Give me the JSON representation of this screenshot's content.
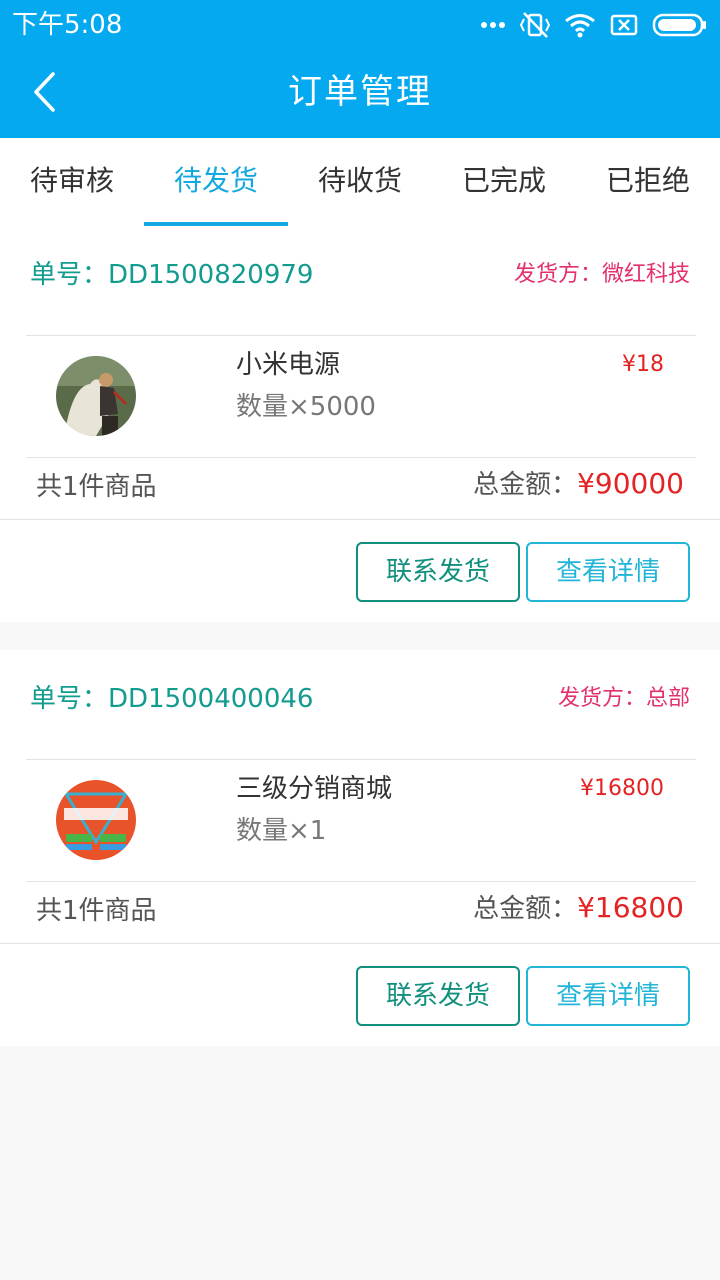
{
  "status_bar": {
    "time": "下午5:08",
    "icons": [
      "more-dots-icon",
      "vibrate-icon",
      "wifi-icon",
      "sim-off-icon",
      "battery-icon"
    ]
  },
  "header": {
    "title": "订单管理",
    "back_icon": "back-arrow-icon"
  },
  "tabs": [
    {
      "label": "待审核",
      "active": false
    },
    {
      "label": "待发货",
      "active": true
    },
    {
      "label": "待收货",
      "active": false
    },
    {
      "label": "已完成",
      "active": false
    },
    {
      "label": "已拒绝",
      "active": false
    }
  ],
  "orders": [
    {
      "order_no": "单号：DD1500820979",
      "shipper": "发货方：微红科技",
      "product_name": "小米电源",
      "quantity": "数量×5000",
      "price": "¥18",
      "item_count": "共1件商品",
      "total_label": "总金额：",
      "total_amount": "¥90000",
      "image_icon": "knight-painting-thumbnail",
      "contact_btn": "联系发货",
      "detail_btn": "查看详情"
    },
    {
      "order_no": "单号：DD1500400046",
      "shipper": "发货方：总部",
      "product_name": "三级分销商城",
      "quantity": "数量×1",
      "price": "¥16800",
      "item_count": "共1件商品",
      "total_label": "总金额：",
      "total_amount": "¥16800",
      "image_icon": "distribution-promo-thumbnail",
      "contact_btn": "联系发货",
      "detail_btn": "查看详情"
    }
  ],
  "colors": {
    "primary": "#04a9f0",
    "tab_active": "#13a8e0",
    "order_no": "#129b8e",
    "shipper": "#e3306f",
    "price": "#e32424",
    "contact_border": "#12907e",
    "detail_border": "#23b5d8",
    "background": "#f8f8f8"
  }
}
